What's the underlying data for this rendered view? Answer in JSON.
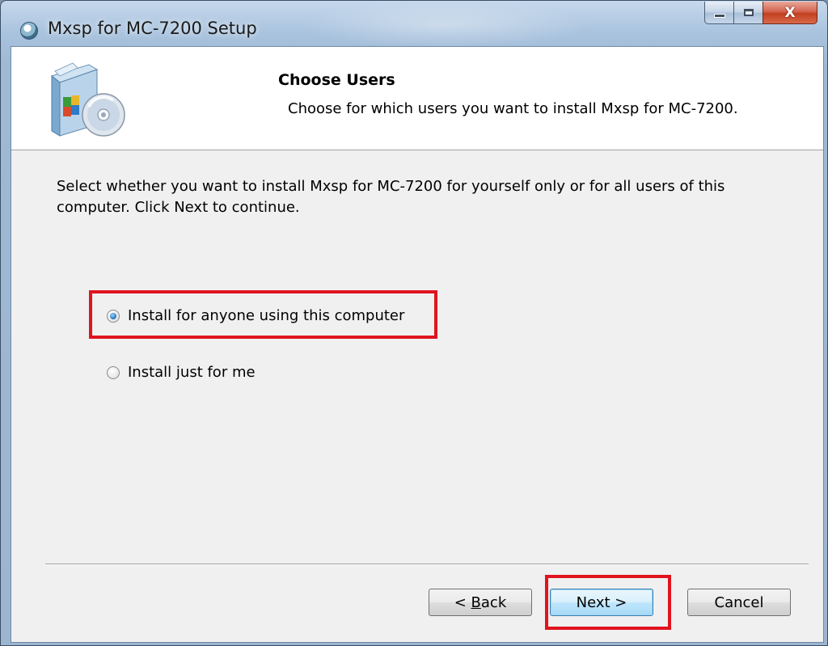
{
  "window": {
    "title": "Mxsp for MC-7200 Setup",
    "close_glyph": "X"
  },
  "header": {
    "title": "Choose Users",
    "subtitle": "Choose for which users you want to install Mxsp for MC-7200."
  },
  "body": {
    "description": "Select whether you want to install Mxsp for MC-7200 for yourself only or for all users of this computer. Click Next to continue.",
    "options": [
      {
        "label": "Install for anyone using this computer",
        "checked": true
      },
      {
        "label": "Install just for me",
        "checked": false
      }
    ]
  },
  "buttons": {
    "back_prefix": "< ",
    "back_accel": "B",
    "back_rest": "ack",
    "next": "Next >",
    "cancel": "Cancel"
  },
  "colors": {
    "highlight": "#e0141e",
    "default_button_border": "#3c7fb1"
  },
  "icons": {
    "app": "setup-disc-icon",
    "header": "software-box-cd-icon"
  }
}
